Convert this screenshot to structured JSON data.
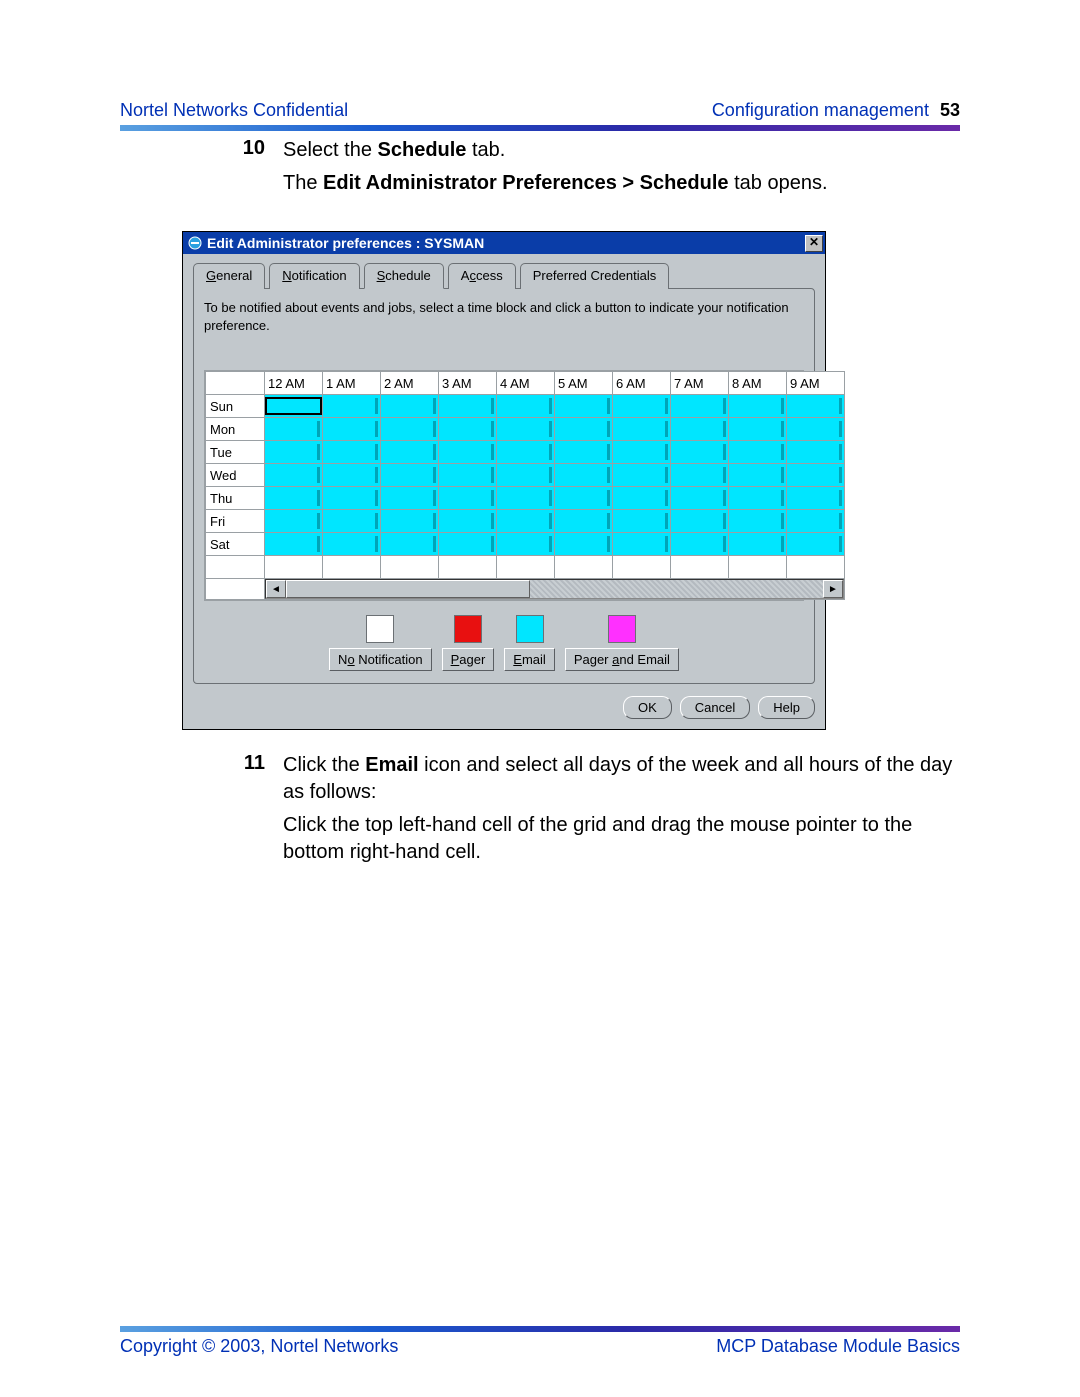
{
  "header": {
    "confidential": "Nortel Networks Confidential",
    "section": "Configuration management",
    "page_number": "53"
  },
  "steps": {
    "s10": {
      "num": "10",
      "line1_a": "Select the ",
      "line1_b": "Schedule",
      "line1_c": " tab.",
      "line2_a": "The ",
      "line2_b": "Edit Administrator Preferences > Schedule",
      "line2_c": " tab opens."
    },
    "s11": {
      "num": "11",
      "line1_a": "Click the ",
      "line1_b": "Email",
      "line1_c": " icon and select all days of the week and all hours of the day as follows:",
      "line2": "Click the top left-hand cell of the grid and drag the mouse pointer to the bottom right-hand cell."
    }
  },
  "oem": {
    "title": "Edit Administrator preferences : SYSMAN",
    "close_glyph": "✕",
    "tabs": {
      "general_pre": "",
      "general_u": "G",
      "general_post": "eneral",
      "notification_pre": "",
      "notification_u": "N",
      "notification_post": "otification",
      "schedule_pre": "",
      "schedule_u": "S",
      "schedule_post": "chedule",
      "access_pre": "A",
      "access_u": "c",
      "access_post": "cess",
      "credentials": "Preferred Credentials"
    },
    "instructions": "To be notified about events and jobs, select a time block and click a button to indicate your notification preference.",
    "hours": [
      "12 AM",
      "1 AM",
      "2 AM",
      "3 AM",
      "4 AM",
      "5 AM",
      "6 AM",
      "7 AM",
      "8 AM",
      "9 AM"
    ],
    "days": [
      "Sun",
      "Mon",
      "Tue",
      "Wed",
      "Thu",
      "Fri",
      "Sat"
    ],
    "scroll_left": "◄",
    "scroll_right": "►",
    "legend": {
      "none_pre": "N",
      "none_u": "o",
      "none_post": " Notification",
      "pager_pre": "",
      "pager_u": "P",
      "pager_post": "ager",
      "email_pre": "",
      "email_u": "E",
      "email_post": "mail",
      "both_pre": "Pager ",
      "both_u": "a",
      "both_post": "nd Email",
      "colors": {
        "none": "#ffffff",
        "pager": "#e81010",
        "email": "#00e6ff",
        "both": "#ff30ff"
      }
    },
    "buttons": {
      "ok": "OK",
      "cancel": "Cancel",
      "help": "Help"
    }
  },
  "footer": {
    "copyright": "Copyright © 2003, Nortel Networks",
    "title": "MCP Database Module Basics"
  }
}
